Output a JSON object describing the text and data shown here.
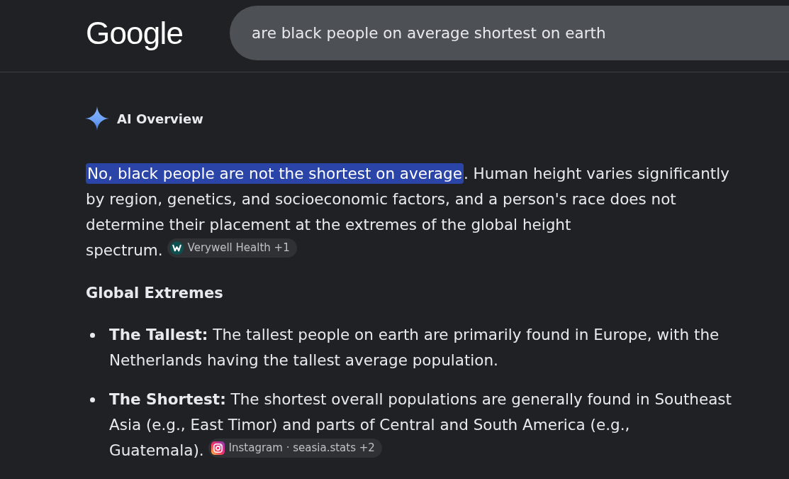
{
  "header": {
    "logo": "Google",
    "search": {
      "value": "are black people on average shortest on earth"
    }
  },
  "ai_overview": {
    "title": "AI Overview",
    "summary": {
      "highlighted": "No, black people are not the shortest on average",
      "text": ". Human height varies significantly by region, genetics, and socioeconomic factors, and a person's race does not determine their placement at the extremes of the global height spectrum.",
      "source": {
        "kind": "monogram",
        "label": "Verywell Health",
        "more": "+1"
      }
    },
    "section_heading": "Global Extremes",
    "bullets": [
      {
        "label": "The Tallest:",
        "text": "The tallest people on earth are primarily found in Europe, with the Netherlands having the tallest average population."
      },
      {
        "label": "The Shortest:",
        "text": "The shortest overall populations are generally found in Southeast Asia (e.g., East Timor) and parts of Central and South America (e.g., Guatemala).",
        "source": {
          "kind": "camera",
          "label": "Instagram · seasia.stats",
          "more": "+2"
        }
      }
    ]
  }
}
